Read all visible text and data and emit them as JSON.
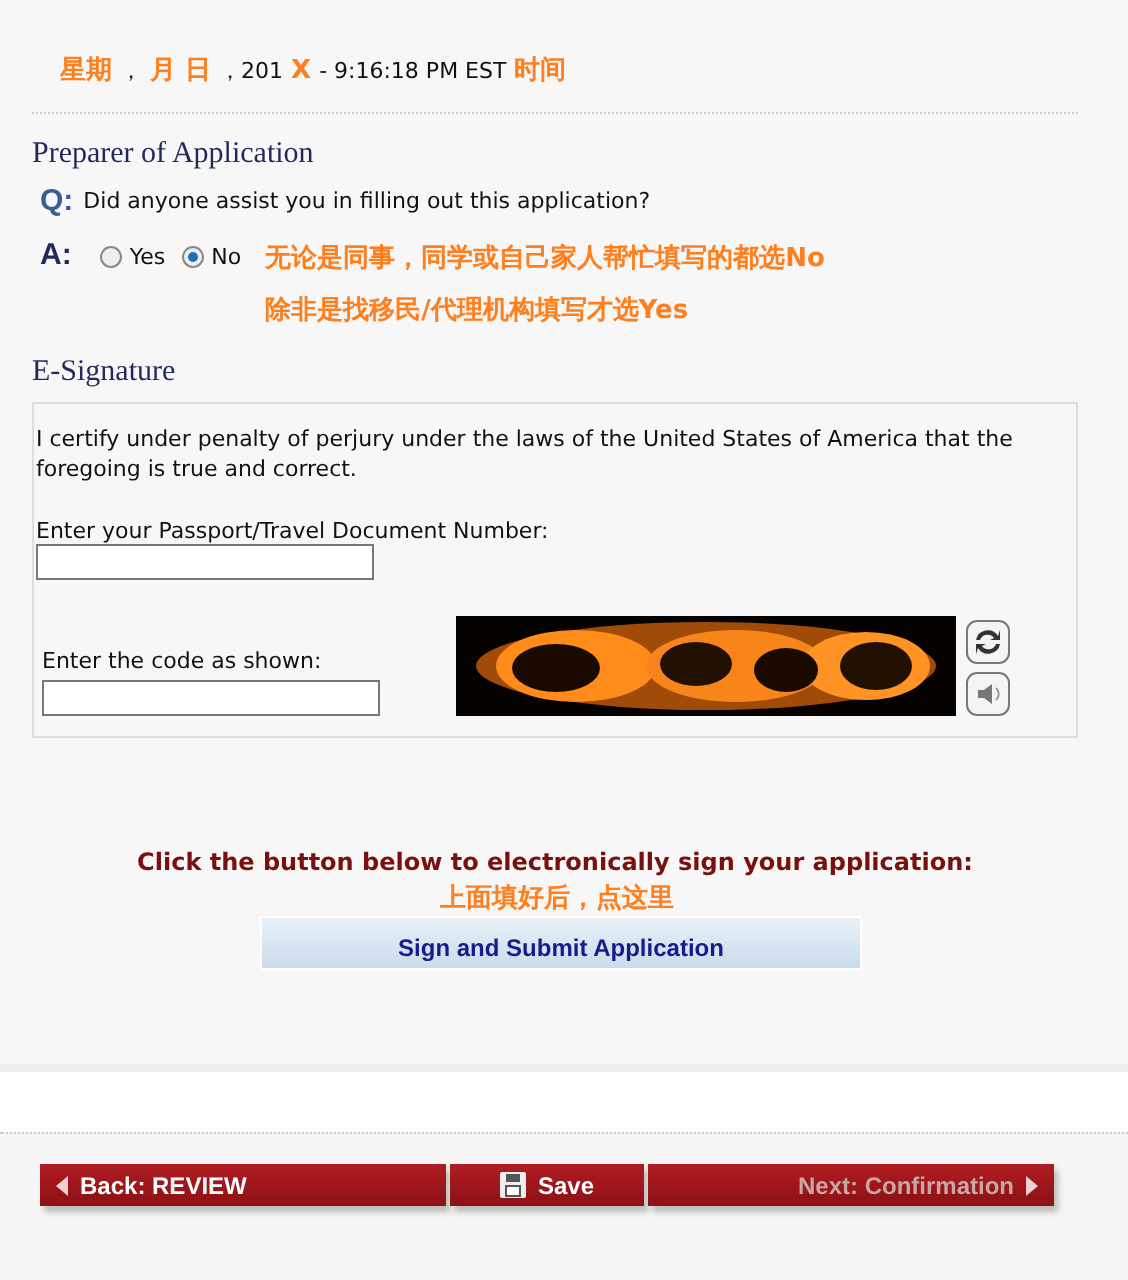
{
  "timestamp": [
    {
      "text": "星期",
      "kind": "note"
    },
    {
      "text": "，",
      "kind": "plain"
    },
    {
      "text": "月 日",
      "kind": "note"
    },
    {
      "text": "，201",
      "kind": "plain"
    },
    {
      "text": "X",
      "kind": "note"
    },
    {
      "text": "- 9:16:18 PM EST",
      "kind": "plain"
    },
    {
      "text": "时间",
      "kind": "note"
    }
  ],
  "preparer": {
    "heading": "Preparer of Application",
    "q_label": "Q:",
    "question": "Did anyone assist you in filling out this application?",
    "a_label": "A:",
    "options": [
      {
        "label": "Yes",
        "selected": false
      },
      {
        "label": "No",
        "selected": true
      }
    ],
    "notes": [
      "无论是同事，同学或自己家人帮忙填写的都选No",
      "除非是找移民/代理机构填写才选Yes"
    ]
  },
  "signature": {
    "heading": "E-Signature",
    "certify": "I certify under penalty of perjury under the laws of the United States of America that the foregoing is true and correct.",
    "passport_label": "Enter your Passport/Travel Document Number:",
    "code_label": "Enter the code as shown:"
  },
  "sign_prompt": "Click the button below to electronically sign your application:",
  "sign_note": "上面填好后，点这里",
  "submit_button": "Sign and Submit Application",
  "nav": [
    {
      "label": "Back: REVIEW",
      "kind": "back",
      "disabled": false
    },
    {
      "label": "Save",
      "kind": "save",
      "disabled": false
    },
    {
      "label": "Next: Confirmation",
      "kind": "next",
      "disabled": true
    }
  ]
}
